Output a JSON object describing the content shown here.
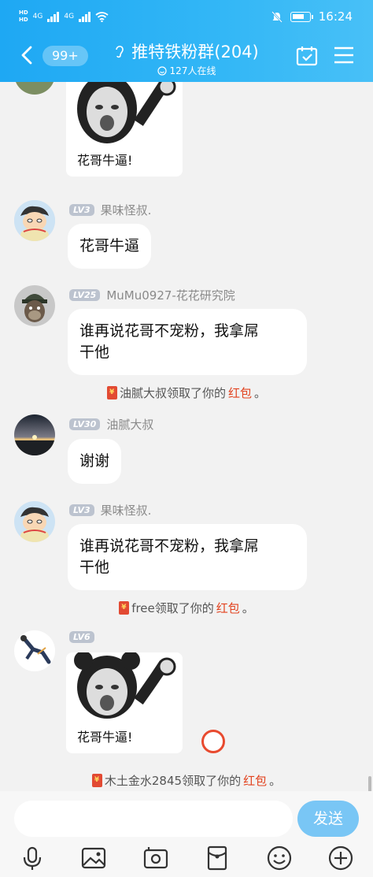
{
  "status_bar": {
    "sim1": "HD",
    "sim2": "HD",
    "net1": "4G",
    "net2": "4G",
    "time": "16:24"
  },
  "header": {
    "unread_count": "99+",
    "group_name": "推特铁粉群(204)",
    "online_count": "127人在线"
  },
  "messages": [
    {
      "sticker_caption": "花哥牛逼!"
    },
    {
      "level": "LV3",
      "sender": "果味怪叔.",
      "text": "花哥牛逼"
    },
    {
      "level": "LV25",
      "sender": "MuMu0927-花花研究院",
      "text_line1": "谁再说花哥不宠粉，我拿屌",
      "text_line2": "干他"
    },
    {
      "system_before": "油腻大叔领取了你的",
      "system_highlight": "红包",
      "system_after": "。"
    },
    {
      "level": "LV30",
      "sender": "油腻大叔",
      "text": "谢谢"
    },
    {
      "level": "LV3",
      "sender": "果味怪叔.",
      "text_line1": "谁再说花哥不宠粉，我拿屌",
      "text_line2": "干他"
    },
    {
      "system_before": "free领取了你的",
      "system_highlight": "红包",
      "system_after": "。"
    },
    {
      "level": "LV6",
      "sender": "",
      "sticker_caption": "花哥牛逼!"
    },
    {
      "system_before": "木土金水2845领取了你的",
      "system_highlight": "红包",
      "system_after": "。"
    }
  ],
  "input": {
    "placeholder": "",
    "send_label": "发送"
  },
  "colors": {
    "header_blue": "#1ea8f3",
    "send_button": "#79c6f5",
    "redpacket_text": "#e2421e",
    "level_badge": "#bcc3cf"
  }
}
